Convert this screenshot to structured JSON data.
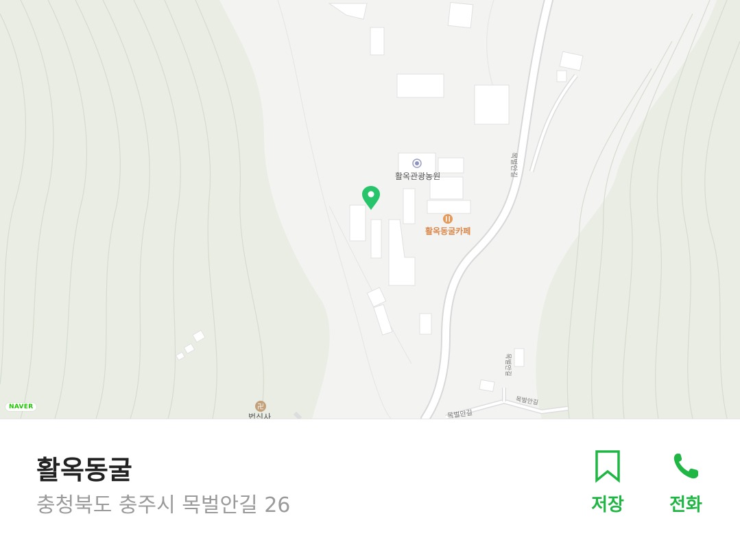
{
  "map": {
    "labels": {
      "poi_farm": "활옥관광농원",
      "cafe": "활옥동굴카페",
      "temple": "법신사",
      "road_vertical": "목벌안길",
      "road_small_vertical": "목벌안길",
      "road_bottom_left": "목벌안길",
      "road_bottom_right": "목벌안길"
    },
    "provider_badge": "NAVER",
    "icons": {
      "marker": "location-pin-icon",
      "farm": "poi-circle-icon",
      "cafe": "fork-knife-icon",
      "temple": "temple-icon"
    },
    "colors": {
      "terrain": "#e9ede4",
      "background": "#f3f3f2",
      "marker": "#27c46c",
      "cafe": "#d9874a"
    }
  },
  "place": {
    "name": "활옥동굴",
    "address": "충청북도 충주시 목벌안길 26"
  },
  "actions": {
    "save_label": "저장",
    "call_label": "전화",
    "save_icon": "bookmark-icon",
    "call_icon": "phone-icon",
    "accent_color": "#1fb644"
  }
}
